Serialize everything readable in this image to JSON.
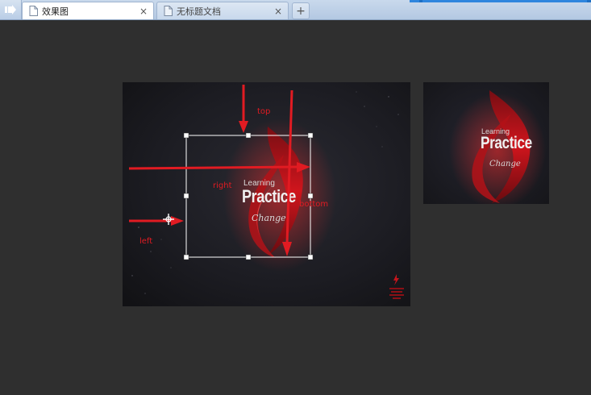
{
  "browser": {
    "tabs": [
      {
        "label": "效果图",
        "active": true
      },
      {
        "label": "无标题文档",
        "active": false
      }
    ],
    "new_tab_symbol": "+",
    "close_symbol": "×"
  },
  "poster": {
    "line1": "Learning",
    "line2": "Practice",
    "line3": "Change"
  },
  "preview": {
    "line1": "Learning",
    "line2": "Practice",
    "line3": "Change"
  },
  "annotations": {
    "top": "top",
    "right": "right",
    "bottom": "bottom",
    "left": "left"
  },
  "colors": {
    "page_bg": "#2f2f2f",
    "annotation_red": "#e11b22",
    "tab_strip": "#b3c8e2",
    "flame_red": "#c4151c"
  },
  "icons": [
    "back-arrow-icon",
    "document-icon",
    "close-icon",
    "plus-icon",
    "crosshair-move-icon",
    "logo-mark-icon"
  ]
}
